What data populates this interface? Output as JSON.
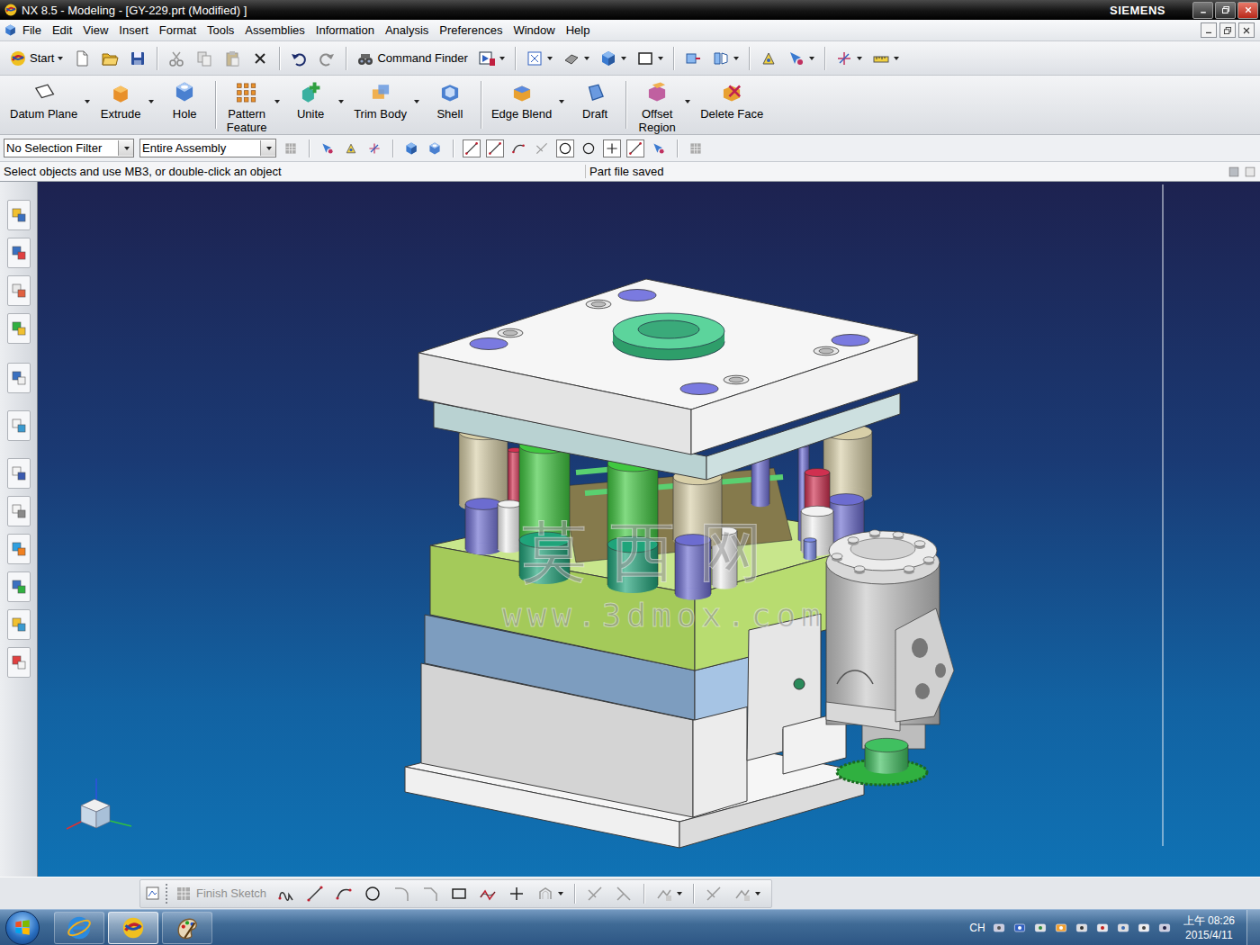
{
  "window": {
    "title": "NX 8.5 - Modeling - [GY-229.prt (Modified) ]",
    "brand": "SIEMENS"
  },
  "menu": [
    "File",
    "Edit",
    "View",
    "Insert",
    "Format",
    "Tools",
    "Assemblies",
    "Information",
    "Analysis",
    "Preferences",
    "Window",
    "Help"
  ],
  "standard_toolbar": {
    "start": "Start",
    "command_finder": "Command Finder"
  },
  "feature_toolbar": [
    {
      "lines": [
        "Datum Plane"
      ],
      "dropdown": true
    },
    {
      "lines": [
        "Extrude"
      ],
      "dropdown": true
    },
    {
      "lines": [
        "Hole"
      ],
      "dropdown": false
    },
    {
      "lines": [
        "Pattern",
        "Feature"
      ],
      "dropdown": true
    },
    {
      "lines": [
        "Unite"
      ],
      "dropdown": true
    },
    {
      "lines": [
        "Trim Body"
      ],
      "dropdown": true
    },
    {
      "lines": [
        "Shell"
      ],
      "dropdown": false
    },
    {
      "lines": [
        "Edge Blend"
      ],
      "dropdown": true
    },
    {
      "lines": [
        "Draft"
      ],
      "dropdown": false
    },
    {
      "lines": [
        "Offset",
        "Region"
      ],
      "dropdown": true
    },
    {
      "lines": [
        "Delete Face"
      ],
      "dropdown": false
    }
  ],
  "selection_bar": {
    "filter": "No Selection Filter",
    "scope": "Entire Assembly"
  },
  "cue_line": {
    "prompt": "Select objects and use MB3, or double-click an object",
    "status": "Part file saved"
  },
  "watermark": {
    "title": "莫西网",
    "url": "www.3dmox.com"
  },
  "sketch_toolbar": {
    "finish": "Finish Sketch",
    "finish_disabled": true
  },
  "taskbar": {
    "apps": [
      {
        "kind": "browser",
        "selected": false
      },
      {
        "kind": "nx",
        "selected": true
      },
      {
        "kind": "paint",
        "selected": false
      }
    ],
    "language": "CH",
    "time": "上午 08:26",
    "date": "2015/4/11"
  }
}
